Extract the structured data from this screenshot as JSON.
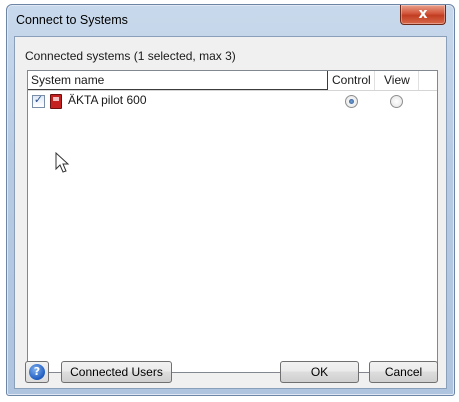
{
  "window": {
    "title": "Connect to Systems",
    "close_glyph": "x"
  },
  "group_label": "Connected systems (1 selected, max 3)",
  "columns": {
    "name": "System name",
    "control": "Control",
    "view": "View"
  },
  "systems": [
    {
      "name": "ÄKTA pilot 600",
      "checked": true,
      "mode": "control",
      "icon": "instrument-icon"
    }
  ],
  "buttons": {
    "help_glyph": "?",
    "connected_users": "Connected Users",
    "ok": "OK",
    "cancel": "Cancel"
  },
  "colors": {
    "title_bar": "#b7cbe4",
    "close_button": "#c13d22",
    "client_bg": "#f0f0f0"
  }
}
